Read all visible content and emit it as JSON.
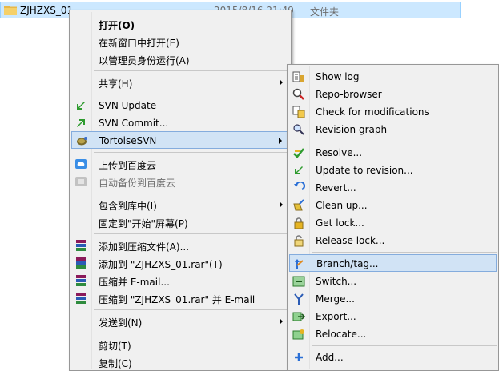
{
  "folder": {
    "name": "ZJHZXS_01",
    "date": "2015/8/16 21:49",
    "type": "文件夹"
  },
  "context_menu": {
    "open": "打开(O)",
    "open_new_window": "在新窗口中打开(E)",
    "run_as_admin": "以管理员身份运行(A)",
    "share": "共享(H)",
    "svn_update": "SVN Update",
    "svn_commit": "SVN Commit...",
    "tortoise_svn": "TortoiseSVN",
    "upload_baidu": "上传到百度云",
    "auto_backup_baidu": "自动备份到百度云",
    "include_in_library": "包含到库中(I)",
    "pin_to_start": "固定到\"开始\"屏幕(P)",
    "add_to_archive": "添加到压缩文件(A)...",
    "add_to_rar": "添加到 \"ZJHZXS_01.rar\"(T)",
    "compress_email": "压缩并 E-mail...",
    "compress_rar_email": "压缩到 \"ZJHZXS_01.rar\" 并 E-mail",
    "send_to": "发送到(N)",
    "cut": "剪切(T)",
    "copy": "复制(C)"
  },
  "svn_submenu": {
    "show_log": "Show log",
    "repo_browser": "Repo-browser",
    "check_modifications": "Check for modifications",
    "revision_graph": "Revision graph",
    "resolve": "Resolve...",
    "update_to_revision": "Update to revision...",
    "revert": "Revert...",
    "clean_up": "Clean up...",
    "get_lock": "Get lock...",
    "release_lock": "Release lock...",
    "branch_tag": "Branch/tag...",
    "switch": "Switch...",
    "merge": "Merge...",
    "export": "Export...",
    "relocate": "Relocate...",
    "add": "Add..."
  }
}
